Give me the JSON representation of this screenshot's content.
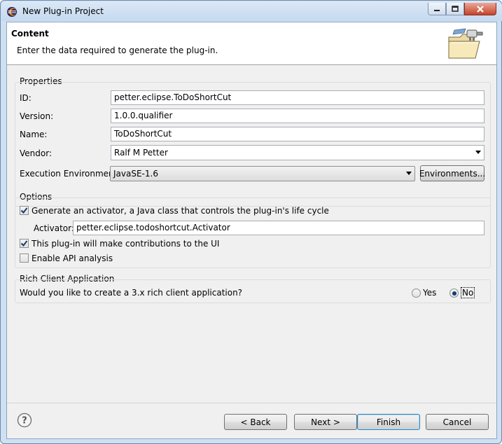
{
  "window": {
    "title": "New Plug-in Project",
    "controls": [
      "minimize-icon",
      "maximize-icon",
      "close-icon"
    ]
  },
  "header": {
    "title": "Content",
    "description": "Enter the data required to generate the plug-in."
  },
  "properties": {
    "group_label": "Properties",
    "id_label": "ID:",
    "id_value": "petter.eclipse.ToDoShortCut",
    "version_label": "Version:",
    "version_value": "1.0.0.qualifier",
    "name_label": "Name:",
    "name_value": "ToDoShortCut",
    "vendor_label": "Vendor:",
    "vendor_value": "Ralf M Petter",
    "exec_env_label": "Execution Environment:",
    "exec_env_value": "JavaSE-1.6",
    "environments_button": "Environments..."
  },
  "options": {
    "group_label": "Options",
    "generate_activator_label": "Generate an activator, a Java class that controls the plug-in's life cycle",
    "generate_activator_checked": true,
    "activator_label": "Activator:",
    "activator_value": "petter.eclipse.todoshortcut.Activator",
    "ui_contributions_label": "This plug-in will make contributions to the UI",
    "ui_contributions_checked": true,
    "api_analysis_label": "Enable API analysis",
    "api_analysis_checked": false
  },
  "rcp": {
    "group_label": "Rich Client Application",
    "question": "Would you like to create a 3.x rich client application?",
    "yes_label": "Yes",
    "no_label": "No",
    "selected": "No"
  },
  "footer": {
    "back_button": "< Back",
    "next_button": "Next >",
    "finish_button": "Finish",
    "cancel_button": "Cancel"
  },
  "colors": {
    "frame": "#cfe0f3",
    "dialog_bg": "#f0f0f0",
    "header_bg": "#ffffff",
    "default_button_border": "#3c7fb1"
  }
}
